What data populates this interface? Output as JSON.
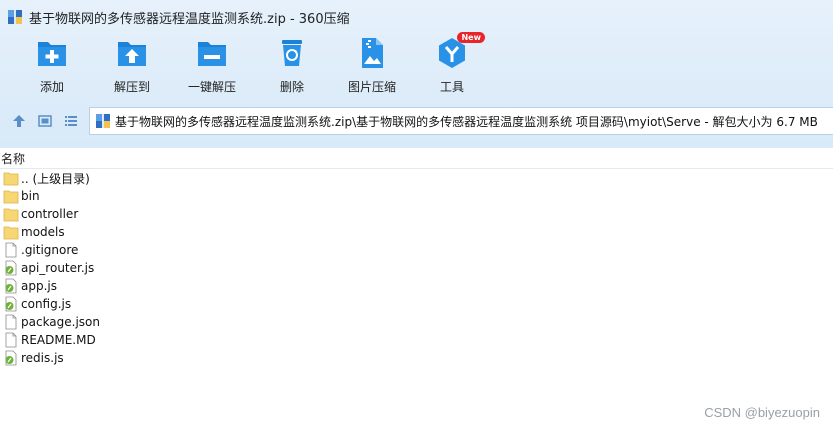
{
  "window": {
    "title": "基于物联网的多传感器远程温度监测系统.zip - 360压缩"
  },
  "toolbar": {
    "items": [
      {
        "label": "添加",
        "icon": "add-icon"
      },
      {
        "label": "解压到",
        "icon": "extract-to-icon"
      },
      {
        "label": "一键解压",
        "icon": "one-click-extract-icon"
      },
      {
        "label": "删除",
        "icon": "delete-icon"
      },
      {
        "label": "图片压缩",
        "icon": "image-compress-icon"
      },
      {
        "label": "工具",
        "icon": "tools-icon",
        "badge": "New"
      }
    ]
  },
  "nav": {
    "icons": [
      "up-arrow-icon",
      "thumbnail-view-icon",
      "list-view-icon"
    ]
  },
  "address": {
    "path": "基于物联网的多传感器远程温度监测系统.zip\\基于物联网的多传感器远程温度监测系统 项目源码\\myiot\\Serve - 解包大小为 6.7 MB"
  },
  "columns": {
    "name": "名称"
  },
  "files": [
    {
      "name": ".. (上级目录)",
      "type": "folder"
    },
    {
      "name": "bin",
      "type": "folder"
    },
    {
      "name": "controller",
      "type": "folder"
    },
    {
      "name": "models",
      "type": "folder"
    },
    {
      "name": ".gitignore",
      "type": "file"
    },
    {
      "name": "api_router.js",
      "type": "js"
    },
    {
      "name": "app.js",
      "type": "js"
    },
    {
      "name": "config.js",
      "type": "js"
    },
    {
      "name": "package.json",
      "type": "file"
    },
    {
      "name": "README.MD",
      "type": "file"
    },
    {
      "name": "redis.js",
      "type": "js"
    }
  ],
  "watermark": "CSDN @biyezuopin",
  "colors": {
    "toolbar_icon": "#1b82d8",
    "folder": "#f7d774",
    "top_background": "#ddeefa",
    "badge": "#e8262a"
  }
}
